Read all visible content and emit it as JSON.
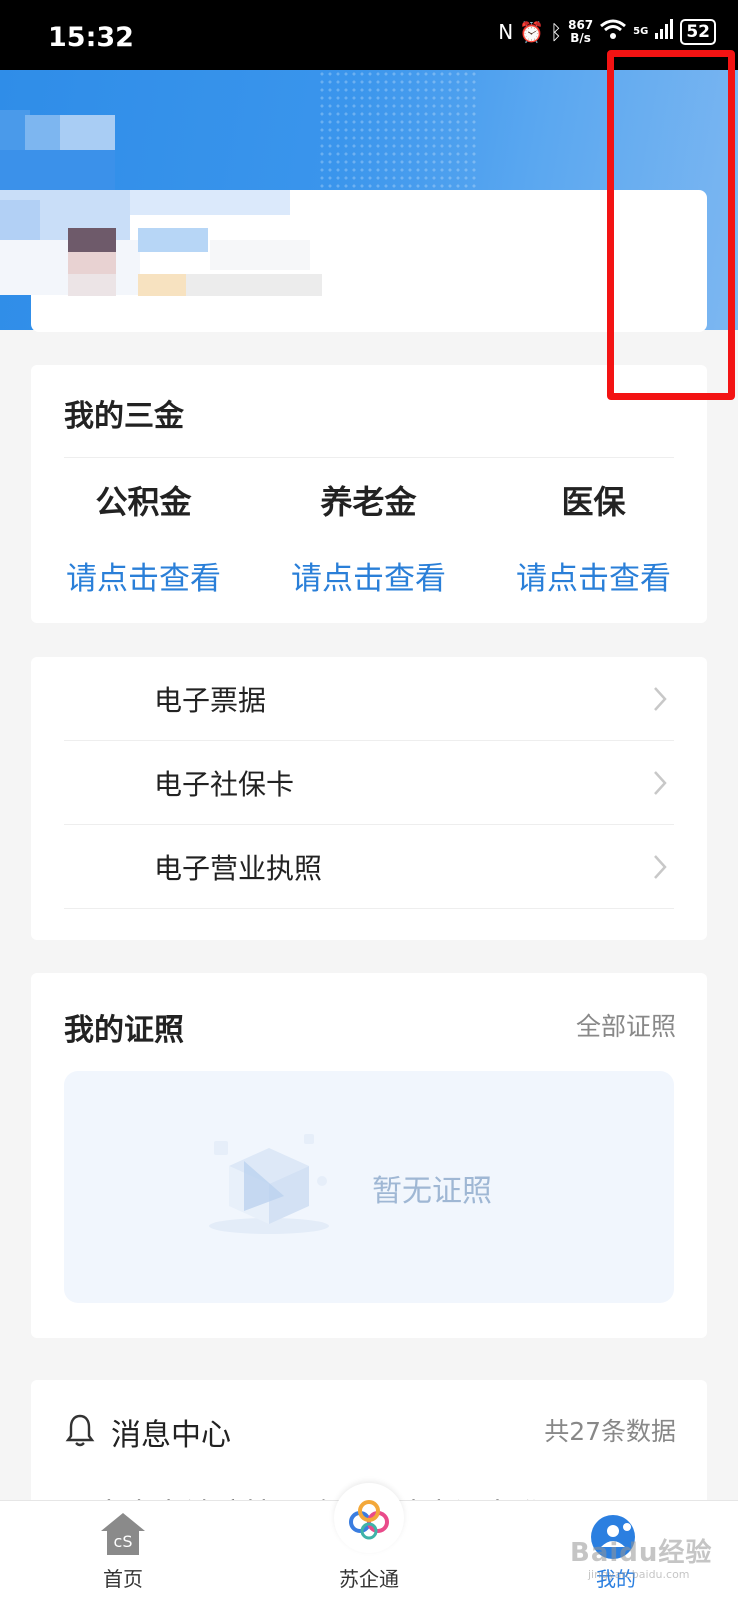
{
  "status_bar": {
    "time": "15:32",
    "net_speed_value": "867",
    "net_speed_unit": "B/s",
    "network": "5G",
    "battery": "52"
  },
  "header": {
    "icons": [
      "bell-icon",
      "scan-icon",
      "gear-icon"
    ]
  },
  "three_gold": {
    "title": "我的三金",
    "items": [
      {
        "name": "公积金",
        "link": "请点击查看"
      },
      {
        "name": "养老金",
        "link": "请点击查看"
      },
      {
        "name": "医保",
        "link": "请点击查看"
      }
    ]
  },
  "services": {
    "items": [
      {
        "label": "电子票据"
      },
      {
        "label": "电子社保卡"
      },
      {
        "label": "电子营业执照"
      }
    ]
  },
  "certificates": {
    "title": "我的证照",
    "all_link": "全部证照",
    "empty_text": "暂无证照"
  },
  "messages": {
    "title": "消息中心",
    "count": "共27条数据",
    "preview": "图中内容被遮挡影响查看请查阅为准"
  },
  "bottom_nav": {
    "items": [
      {
        "label": "首页",
        "active": false
      },
      {
        "label": "苏企通",
        "active": false
      },
      {
        "label": "我的",
        "active": true
      }
    ]
  },
  "watermark": {
    "text": "Baidu经验",
    "sub": "jingyan.baidu.com"
  },
  "colors": {
    "header_blue": "#2f8de8",
    "link_blue": "#2a7fd8",
    "highlight_red": "#f31313",
    "nav_active": "#2b7fe0"
  }
}
